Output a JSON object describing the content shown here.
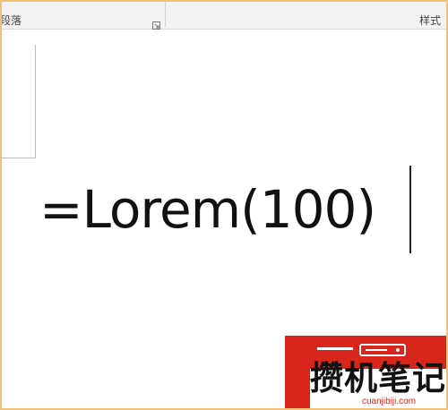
{
  "ribbon": {
    "paragraph_group_label": "段落",
    "styles_group_label": "样式"
  },
  "document": {
    "formula_text": "=Lorem(100)"
  },
  "watermark": {
    "name": "攒机笔记",
    "url": "cuanjibiji.com"
  }
}
